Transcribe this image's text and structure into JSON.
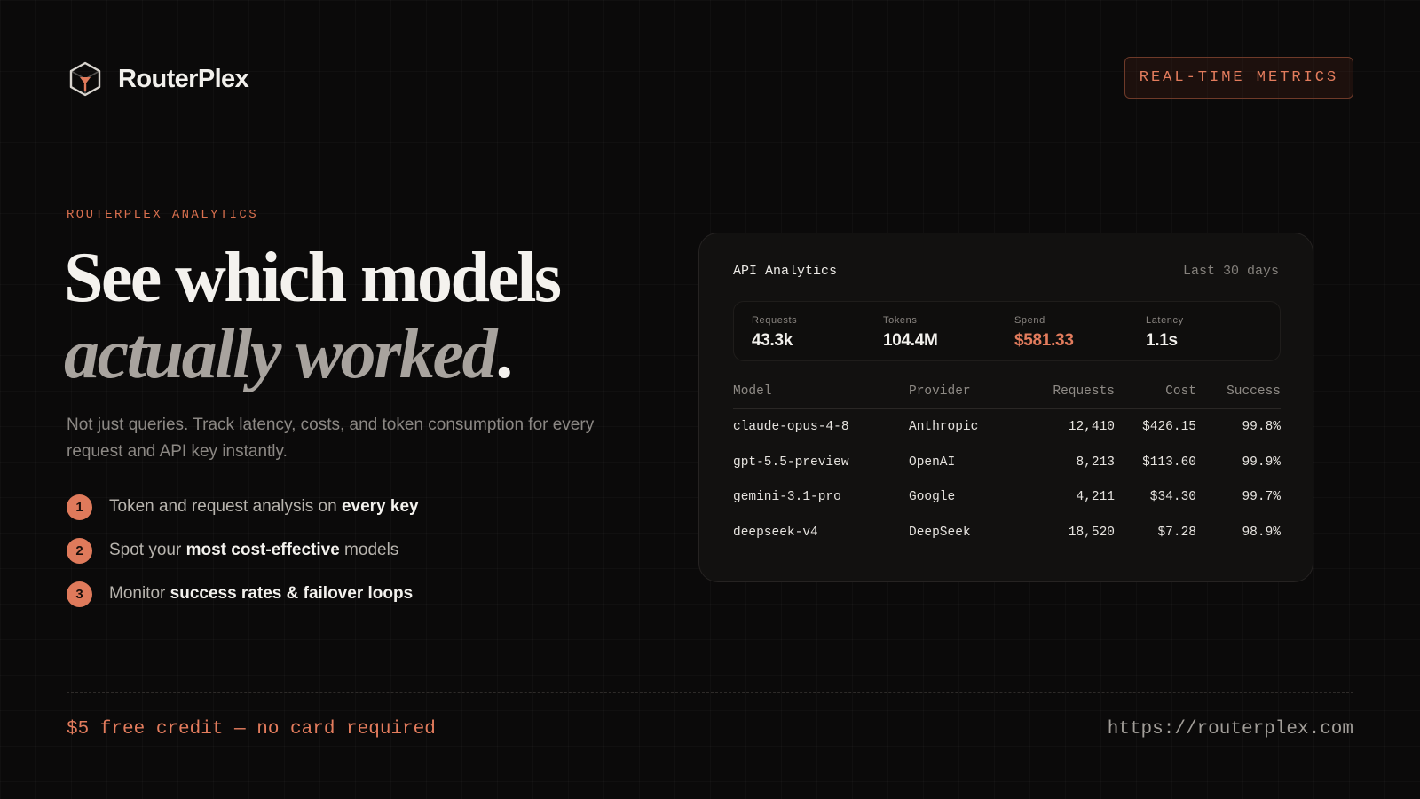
{
  "brand": {
    "name": "RouterPlex",
    "logo_icon": "cube-icon",
    "accent": "#df7a5b"
  },
  "badge": {
    "label": "REAL-TIME METRICS"
  },
  "hero": {
    "eyebrow": "ROUTERPLEX ANALYTICS",
    "headline_line1": "See which models",
    "headline_line2": "actually worked",
    "headline_period": ".",
    "description": "Not just queries. Track latency, costs, and token consumption for every request and API key instantly."
  },
  "features": [
    {
      "number": "1",
      "text_before": "Token and request analysis on ",
      "emphasis": "every key",
      "text_after": ""
    },
    {
      "number": "2",
      "text_before": "Spot your ",
      "emphasis": "most cost-effective",
      "text_after": " models"
    },
    {
      "number": "3",
      "text_before": "Monitor ",
      "emphasis": "success rates & failover loops",
      "text_after": ""
    }
  ],
  "analytics": {
    "title": "API Analytics",
    "range": "Last 30 days",
    "stats": [
      {
        "label": "Requests",
        "value": "43.3k"
      },
      {
        "label": "Tokens",
        "value": "104.4M"
      },
      {
        "label": "Spend",
        "value": "$581.33"
      },
      {
        "label": "Latency",
        "value": "1.1s"
      }
    ],
    "columns": [
      "Model",
      "Provider",
      "Requests",
      "Cost",
      "Success"
    ],
    "rows": [
      [
        "claude-opus-4-8",
        "Anthropic",
        "12,410",
        "$426.15",
        "99.8%"
      ],
      [
        "gpt-5.5-preview",
        "OpenAI",
        "8,213",
        "$113.60",
        "99.9%"
      ],
      [
        "gemini-3.1-pro",
        "Google",
        "4,211",
        "$34.30",
        "99.7%"
      ],
      [
        "deepseek-v4",
        "DeepSeek",
        "18,520",
        "$7.28",
        "98.9%"
      ]
    ]
  },
  "footer": {
    "offer": "$5 free credit — no card required",
    "url": "https://routerplex.com"
  }
}
